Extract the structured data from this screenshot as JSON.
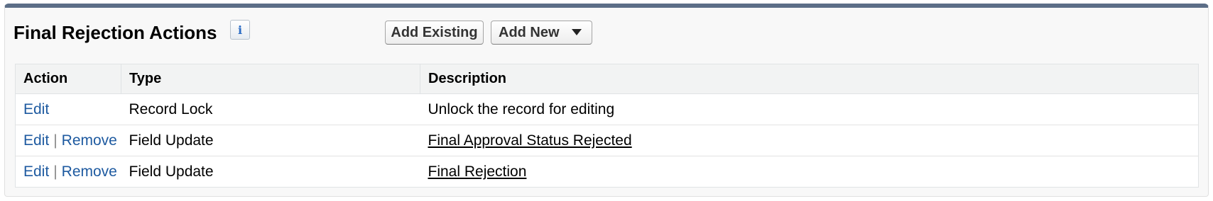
{
  "section": {
    "title": "Final Rejection Actions",
    "info_icon": "info-icon",
    "add_existing_label": "Add Existing",
    "add_new_label": "Add New"
  },
  "table": {
    "headers": [
      "Action",
      "Type",
      "Description"
    ],
    "rows": [
      {
        "edit": "Edit",
        "remove": "",
        "separator": "",
        "type": "Record Lock",
        "description": "Unlock the record for editing"
      },
      {
        "edit": "Edit",
        "remove": "Remove",
        "separator": "|",
        "type": "Field Update",
        "description": "Final Approval Status Rejected"
      },
      {
        "edit": "Edit",
        "remove": "Remove",
        "separator": "|",
        "type": "Field Update",
        "description": "Final Rejection"
      }
    ]
  },
  "colors": {
    "header_bar": "#5c6e87",
    "link": "#1e5aa0"
  }
}
